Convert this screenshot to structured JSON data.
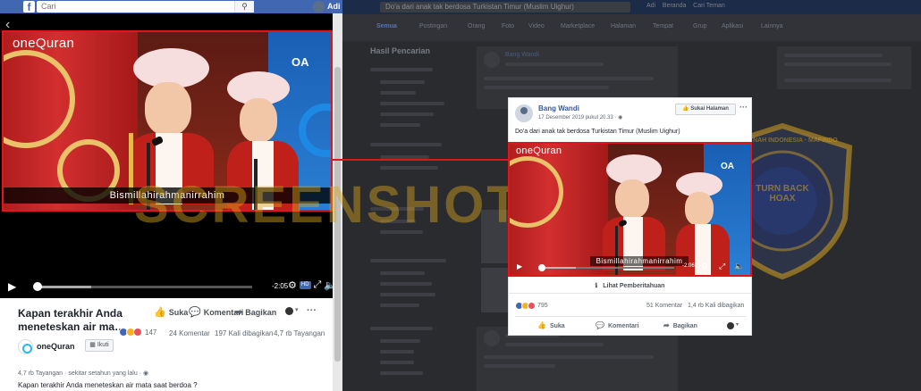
{
  "colors": {
    "facebook_blue": "#4267b2",
    "highlight_red": "#e0161b",
    "link_blue": "#385898",
    "watermark_gold": "#d6a31e",
    "brand_cyan": "#29b6f6"
  },
  "left_panel": {
    "topbar": {
      "logo_icon": "facebook-f-icon",
      "search_placeholder": "Cari",
      "search_icon": "search-icon",
      "user_name": "Adi"
    },
    "back_icon": "chevron-left-icon",
    "video": {
      "brand": "oneQuran",
      "caption": "Bismillahirahmanirrahim",
      "banner_logo": "OA"
    },
    "controls": {
      "time_remaining": "-2:05",
      "hd_badge": "HD",
      "icons": [
        "play-icon",
        "gear-icon",
        "fullscreen-icon",
        "volume-icon"
      ]
    },
    "info": {
      "title": "Kapan terakhir Anda meneteskan air ma…",
      "actions": {
        "like": "Suka",
        "comment": "Komentari",
        "share": "Bagikan"
      },
      "reaction_count": "147",
      "comments": "24 Komentar",
      "shares": "197 Kali dibagikan",
      "views": "4,7 rb Tayangan",
      "page_name": "oneQuran",
      "follow_label": "Ikuti",
      "meta_views": "4,7 rb Tayangan",
      "meta_time": "sekitar setahun yang lalu",
      "description": "Kapan terakhir Anda meneteskan air mata saat berdoa ?"
    }
  },
  "background_page": {
    "search_text": "Do'a dari anak tak berdosa Turkistan Timur (Muslim Uighur)",
    "nav_user": "Adi",
    "nav_items": [
      "Beranda",
      "Cari Teman"
    ],
    "tabs": [
      "Semua",
      "Postingan",
      "Orang",
      "Foto",
      "Video",
      "Marketplace",
      "Halaman",
      "Tempat",
      "Grup",
      "Aplikasi",
      "Lainnya"
    ],
    "sidebar_title": "Hasil Pencarian",
    "result_author": "Bang Wandi"
  },
  "watermark": {
    "text": "SCREENSHOT BY",
    "shield_text_top": "TURN BACK HOAX",
    "shield_text_ring": "ANTI FITNAH INDONESIA · MAFINDO"
  },
  "popup": {
    "author": "Bang Wandi",
    "timestamp": "17 Desember 2019 pukul 20.33",
    "like_page_button": "Sukai Halaman",
    "post_text": "Do'a dari anak tak berdosa Turkistan Timur (Muslim Uighur)",
    "video": {
      "brand": "oneQuran",
      "caption": "Bismillahirahmanirrahim",
      "banner_logo": "OA",
      "time_remaining": "-2:06"
    },
    "notice": "Lihat Pemberitahuan",
    "reaction_count": "795",
    "comments": "51 Komentar",
    "shares": "1,4 rb Kali dibagikan",
    "actions": {
      "like": "Suka",
      "comment": "Komentari",
      "share": "Bagikan"
    }
  }
}
